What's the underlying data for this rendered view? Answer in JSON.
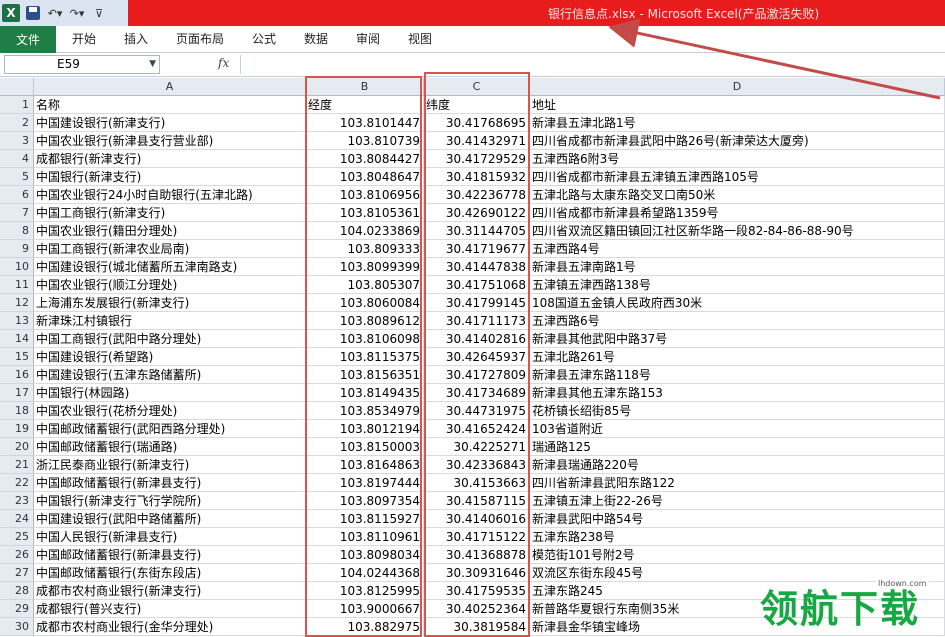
{
  "window": {
    "title": "银行信息点.xlsx - Microsoft Excel(产品激活失败)"
  },
  "ribbon": {
    "tabs": [
      "文件",
      "开始",
      "插入",
      "页面布局",
      "公式",
      "数据",
      "审阅",
      "视图"
    ]
  },
  "formula_bar": {
    "name_box": "E59",
    "fx_label": "fx",
    "value": ""
  },
  "columns": [
    "A",
    "B",
    "C",
    "D"
  ],
  "rows": [
    [
      "名称",
      "经度",
      "纬度",
      "地址"
    ],
    [
      "中国建设银行(新津支行)",
      "103.8101447",
      "30.41768695",
      "新津县五津北路1号"
    ],
    [
      "中国农业银行(新津县支行营业部)",
      "103.810739",
      "30.41432971",
      "四川省成都市新津县武阳中路26号(新津荣达大厦旁)"
    ],
    [
      "成都银行(新津支行)",
      "103.8084427",
      "30.41729529",
      "五津西路6附3号"
    ],
    [
      "中国银行(新津支行)",
      "103.8048647",
      "30.41815932",
      "四川省成都市新津县五津镇五津西路105号"
    ],
    [
      "中国农业银行24小时自助银行(五津北路)",
      "103.8106956",
      "30.42236778",
      "五津北路与太康东路交叉口南50米"
    ],
    [
      "中国工商银行(新津支行)",
      "103.8105361",
      "30.42690122",
      "四川省成都市新津县希望路1359号"
    ],
    [
      "中国农业银行(籍田分理处)",
      "104.0233869",
      "30.31144705",
      "四川省双流区籍田镇回江社区新华路一段82-84-86-88-90号"
    ],
    [
      "中国工商银行(新津农业局南)",
      "103.809333",
      "30.41719677",
      "五津西路4号"
    ],
    [
      "中国建设银行(城北储蓄所五津南路支)",
      "103.8099399",
      "30.41447838",
      "新津县五津南路1号"
    ],
    [
      "中国农业银行(顺江分理处)",
      "103.805307",
      "30.41751068",
      "五津镇五津西路138号"
    ],
    [
      "上海浦东发展银行(新津支行)",
      "103.8060084",
      "30.41799145",
      "108国道五金镇人民政府西30米"
    ],
    [
      "新津珠江村镇银行",
      "103.8089612",
      "30.41711173",
      "五津西路6号"
    ],
    [
      "中国工商银行(武阳中路分理处)",
      "103.8106098",
      "30.41402816",
      "新津县其他武阳中路37号"
    ],
    [
      "中国建设银行(希望路)",
      "103.8115375",
      "30.42645937",
      "五津北路261号"
    ],
    [
      "中国建设银行(五津东路储蓄所)",
      "103.8156351",
      "30.41727809",
      "新津县五津东路118号"
    ],
    [
      "中国银行(林园路)",
      "103.8149435",
      "30.41734689",
      "新津县其他五津东路153"
    ],
    [
      "中国农业银行(花桥分理处)",
      "103.8534979",
      "30.44731975",
      "花桥镇长绍街85号"
    ],
    [
      "中国邮政储蓄银行(武阳西路分理处)",
      "103.8012194",
      "30.41652424",
      "103省道附近"
    ],
    [
      "中国邮政储蓄银行(瑞通路)",
      "103.8150003",
      "30.4225271",
      "瑞通路125"
    ],
    [
      "浙江民泰商业银行(新津支行)",
      "103.8164863",
      "30.42336843",
      "新津县瑞通路220号"
    ],
    [
      "中国邮政储蓄银行(新津县支行)",
      "103.8197444",
      "30.4153663",
      "四川省新津县武阳东路122"
    ],
    [
      "中国银行(新津支行飞行学院所)",
      "103.8097354",
      "30.41587115",
      "五津镇五津上街22-26号"
    ],
    [
      "中国建设银行(武阳中路储蓄所)",
      "103.8115927",
      "30.41406016",
      "新津县武阳中路54号"
    ],
    [
      "中国人民银行(新津县支行)",
      "103.8110961",
      "30.41715122",
      "五津东路238号"
    ],
    [
      "中国邮政储蓄银行(新津县支行)",
      "103.8098034",
      "30.41368878",
      "模范街101号附2号"
    ],
    [
      "中国邮政储蓄银行(东街东段店)",
      "104.0244368",
      "30.30931646",
      "双流区东街东段45号"
    ],
    [
      "成都市农村商业银行(新津支行)",
      "103.8125995",
      "30.41759535",
      "五津东路245"
    ],
    [
      "成都银行(普兴支行)",
      "103.9000667",
      "30.40252364",
      "新普路华夏银行东南侧35米"
    ],
    [
      "成都市农村商业银行(金华分理处)",
      "103.882975",
      "30.3819584",
      "新津县金华镇宝峰场"
    ]
  ],
  "watermark": {
    "logo_text": "领航下载",
    "url": "lhdown.com"
  },
  "accent_colors": {
    "titlebar_red": "#e81c1c",
    "file_tab_green": "#1f7e45",
    "highlight_red": "#d9534f"
  }
}
